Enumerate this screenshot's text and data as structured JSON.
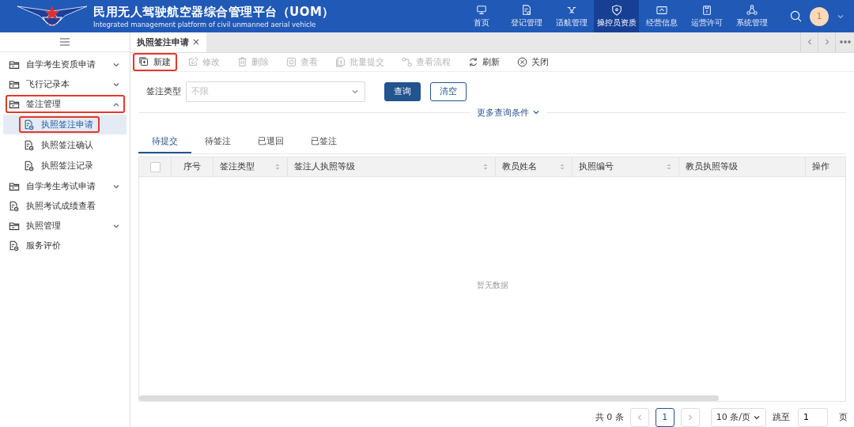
{
  "header": {
    "title": "民用无人驾驶航空器综合管理平台（UOM）",
    "subtitle": "Integrated management platform of civil unmanned aerial vehicle",
    "nav": [
      {
        "label": "首页",
        "selected": false
      },
      {
        "label": "登记管理",
        "selected": false
      },
      {
        "label": "适航管理",
        "selected": false
      },
      {
        "label": "操控员资质",
        "selected": true
      },
      {
        "label": "经营信息",
        "selected": false
      },
      {
        "label": "运营许可",
        "selected": false
      },
      {
        "label": "系统管理",
        "selected": false
      }
    ],
    "avatar": "1"
  },
  "sidebar": {
    "items": [
      {
        "label": "自学考生资质申请",
        "kind": "folder",
        "expanded": false,
        "highlighted": false
      },
      {
        "label": "飞行记录本",
        "kind": "folder",
        "expanded": false,
        "highlighted": false
      },
      {
        "label": "签注管理",
        "kind": "folder",
        "expanded": true,
        "highlighted": true,
        "children": [
          {
            "label": "执照签注申请",
            "selected": true,
            "highlighted": true
          },
          {
            "label": "执照签注确认",
            "selected": false,
            "highlighted": false
          },
          {
            "label": "执照签注记录",
            "selected": false,
            "highlighted": false
          }
        ]
      },
      {
        "label": "自学考生考试申请",
        "kind": "folder",
        "expanded": false,
        "highlighted": false
      },
      {
        "label": "执照考试成绩查看",
        "kind": "file",
        "highlighted": false
      },
      {
        "label": "执照管理",
        "kind": "folder",
        "expanded": false,
        "highlighted": false
      },
      {
        "label": "服务评价",
        "kind": "file",
        "highlighted": false
      }
    ]
  },
  "page_tabs": [
    {
      "label": "执照签注申请",
      "close": "×",
      "selected": true
    }
  ],
  "toolbar": [
    {
      "label": "新建",
      "disabled": false,
      "highlighted": true
    },
    {
      "label": "修改",
      "disabled": true,
      "highlighted": false
    },
    {
      "label": "删除",
      "disabled": true,
      "highlighted": false
    },
    {
      "label": "查看",
      "disabled": true,
      "highlighted": false
    },
    {
      "label": "批量提交",
      "disabled": true,
      "highlighted": false
    },
    {
      "label": "查看流程",
      "disabled": true,
      "highlighted": false
    },
    {
      "label": "刷新",
      "disabled": false,
      "highlighted": false
    },
    {
      "label": "关闭",
      "disabled": false,
      "highlighted": false
    }
  ],
  "filter": {
    "label": "签注类型",
    "placeholder": "不限",
    "query_button": "查询",
    "clear_button": "清空",
    "more": "更多查询条件"
  },
  "status_tabs": [
    {
      "label": "待提交",
      "selected": true
    },
    {
      "label": "待签注",
      "selected": false
    },
    {
      "label": "已退回",
      "selected": false
    },
    {
      "label": "已签注",
      "selected": false
    }
  ],
  "table": {
    "select_all_checked": false,
    "columns": [
      {
        "label": "序号",
        "sortable": false
      },
      {
        "label": "签注类型",
        "sortable": true
      },
      {
        "label": "签注人执照等级",
        "sortable": true
      },
      {
        "label": "教员姓名",
        "sortable": true
      },
      {
        "label": "执照编号",
        "sortable": true
      },
      {
        "label": "教员执照等级",
        "sortable": false
      },
      {
        "label": "操作",
        "sortable": false
      }
    ],
    "empty_text": "暂无数据"
  },
  "pagination": {
    "total": "共 0 条",
    "page": "1",
    "page_size": "10 条/页",
    "jump_label": "跳至",
    "jump_value": "1",
    "page_unit": "页"
  }
}
